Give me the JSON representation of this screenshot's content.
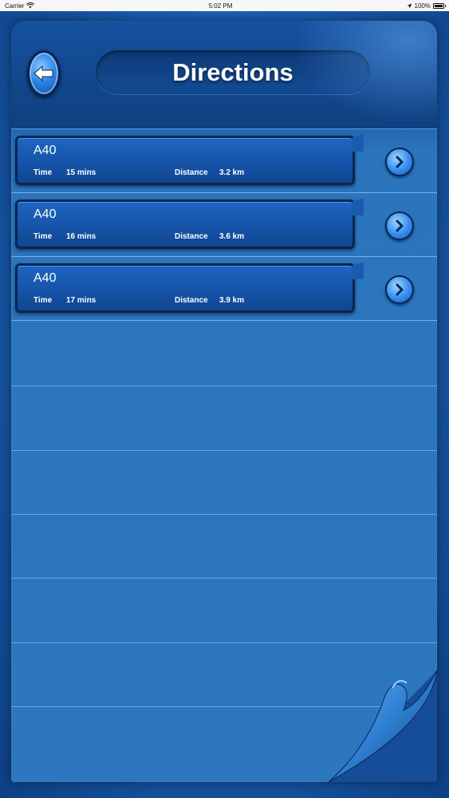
{
  "status_bar": {
    "carrier": "Carrier",
    "time": "5:02 PM",
    "battery": "100%"
  },
  "header": {
    "title": "Directions"
  },
  "routes": [
    {
      "name": "A40",
      "time_label": "Time",
      "time": "15 mins",
      "distance_label": "Distance",
      "distance": "3.2 km"
    },
    {
      "name": "A40",
      "time_label": "Time",
      "time": "16 mins",
      "distance_label": "Distance",
      "distance": "3.6 km"
    },
    {
      "name": "A40",
      "time_label": "Time",
      "time": "17 mins",
      "distance_label": "Distance",
      "distance": "3.9 km"
    }
  ],
  "icons": {
    "back": "back-arrow-icon",
    "details": "chevron-right-icon",
    "wifi": "wifi-icon",
    "location": "location-arrow-icon",
    "battery": "battery-icon"
  },
  "colors": {
    "background": "#1a5fb0",
    "panel": "#2d77be",
    "header": "#0f3f80",
    "text": "#ffffff"
  }
}
